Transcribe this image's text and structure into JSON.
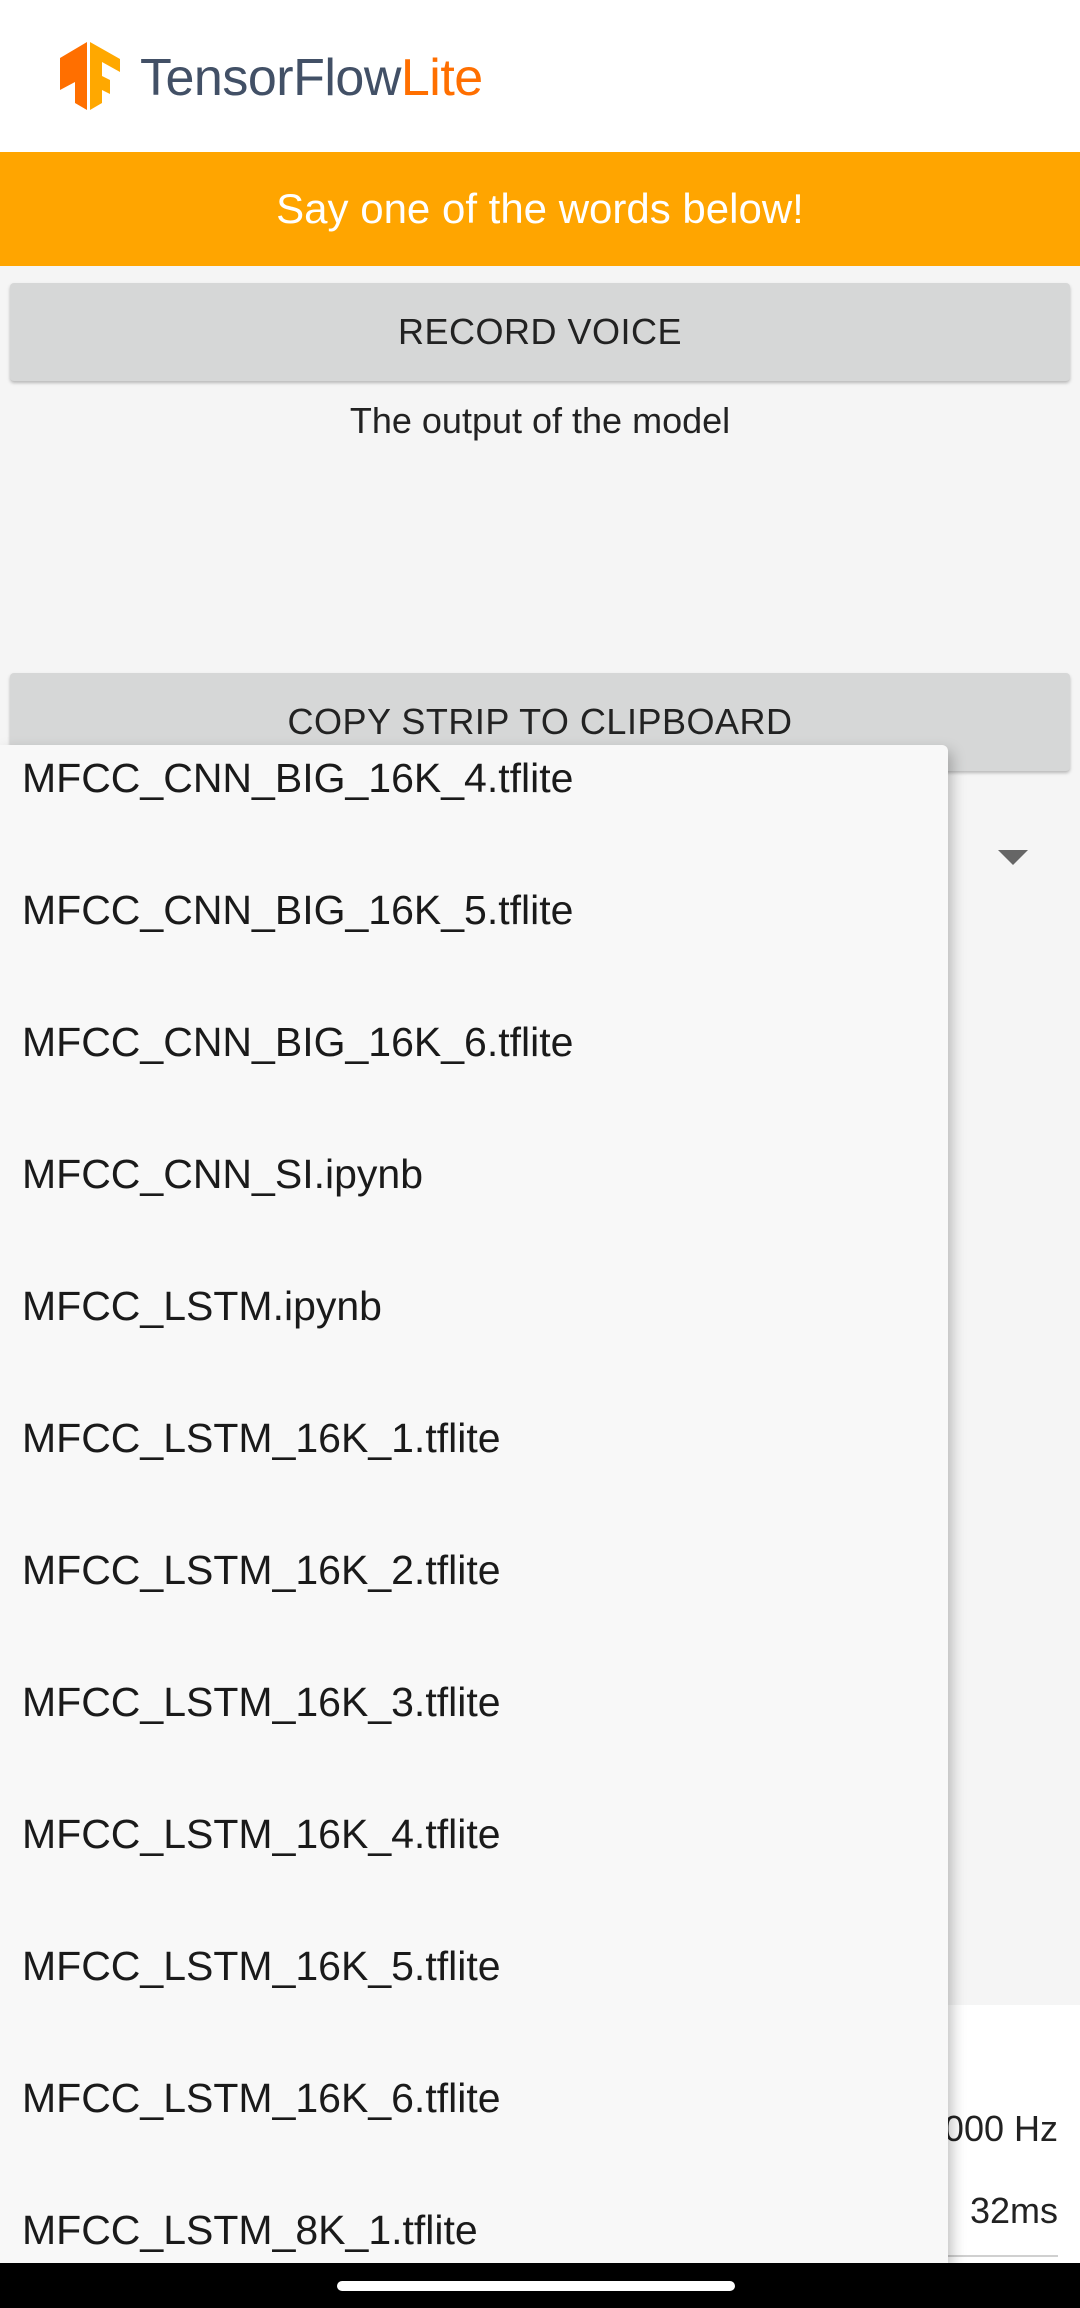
{
  "app": {
    "brand_part1": "TensorFlow",
    "brand_part2": "Lite",
    "brand_colors": {
      "tensorflow": "#425066",
      "lite": "#ff6f00"
    },
    "logo_icon": "tensorflow-logo-icon"
  },
  "banner": {
    "text": "Say one of the words below!",
    "color": "#ffa500"
  },
  "buttons": {
    "record": "RECORD VOICE",
    "copy": "COPY STRIP TO CLIPBOARD"
  },
  "output": {
    "label": "The output of the model"
  },
  "model_dropdown": {
    "options": [
      "MFCC_CNN_BIG_16K_4.tflite",
      "MFCC_CNN_BIG_16K_5.tflite",
      "MFCC_CNN_BIG_16K_6.tflite",
      "MFCC_CNN_SI.ipynb",
      "MFCC_LSTM.ipynb",
      "MFCC_LSTM_16K_1.tflite",
      "MFCC_LSTM_16K_2.tflite",
      "MFCC_LSTM_16K_3.tflite",
      "MFCC_LSTM_16K_4.tflite",
      "MFCC_LSTM_16K_5.tflite",
      "MFCC_LSTM_16K_6.tflite",
      "MFCC_LSTM_8K_1.tflite"
    ]
  },
  "bottom_sheet": {
    "sample_rate": "000 Hz",
    "inference_time": "32ms"
  }
}
